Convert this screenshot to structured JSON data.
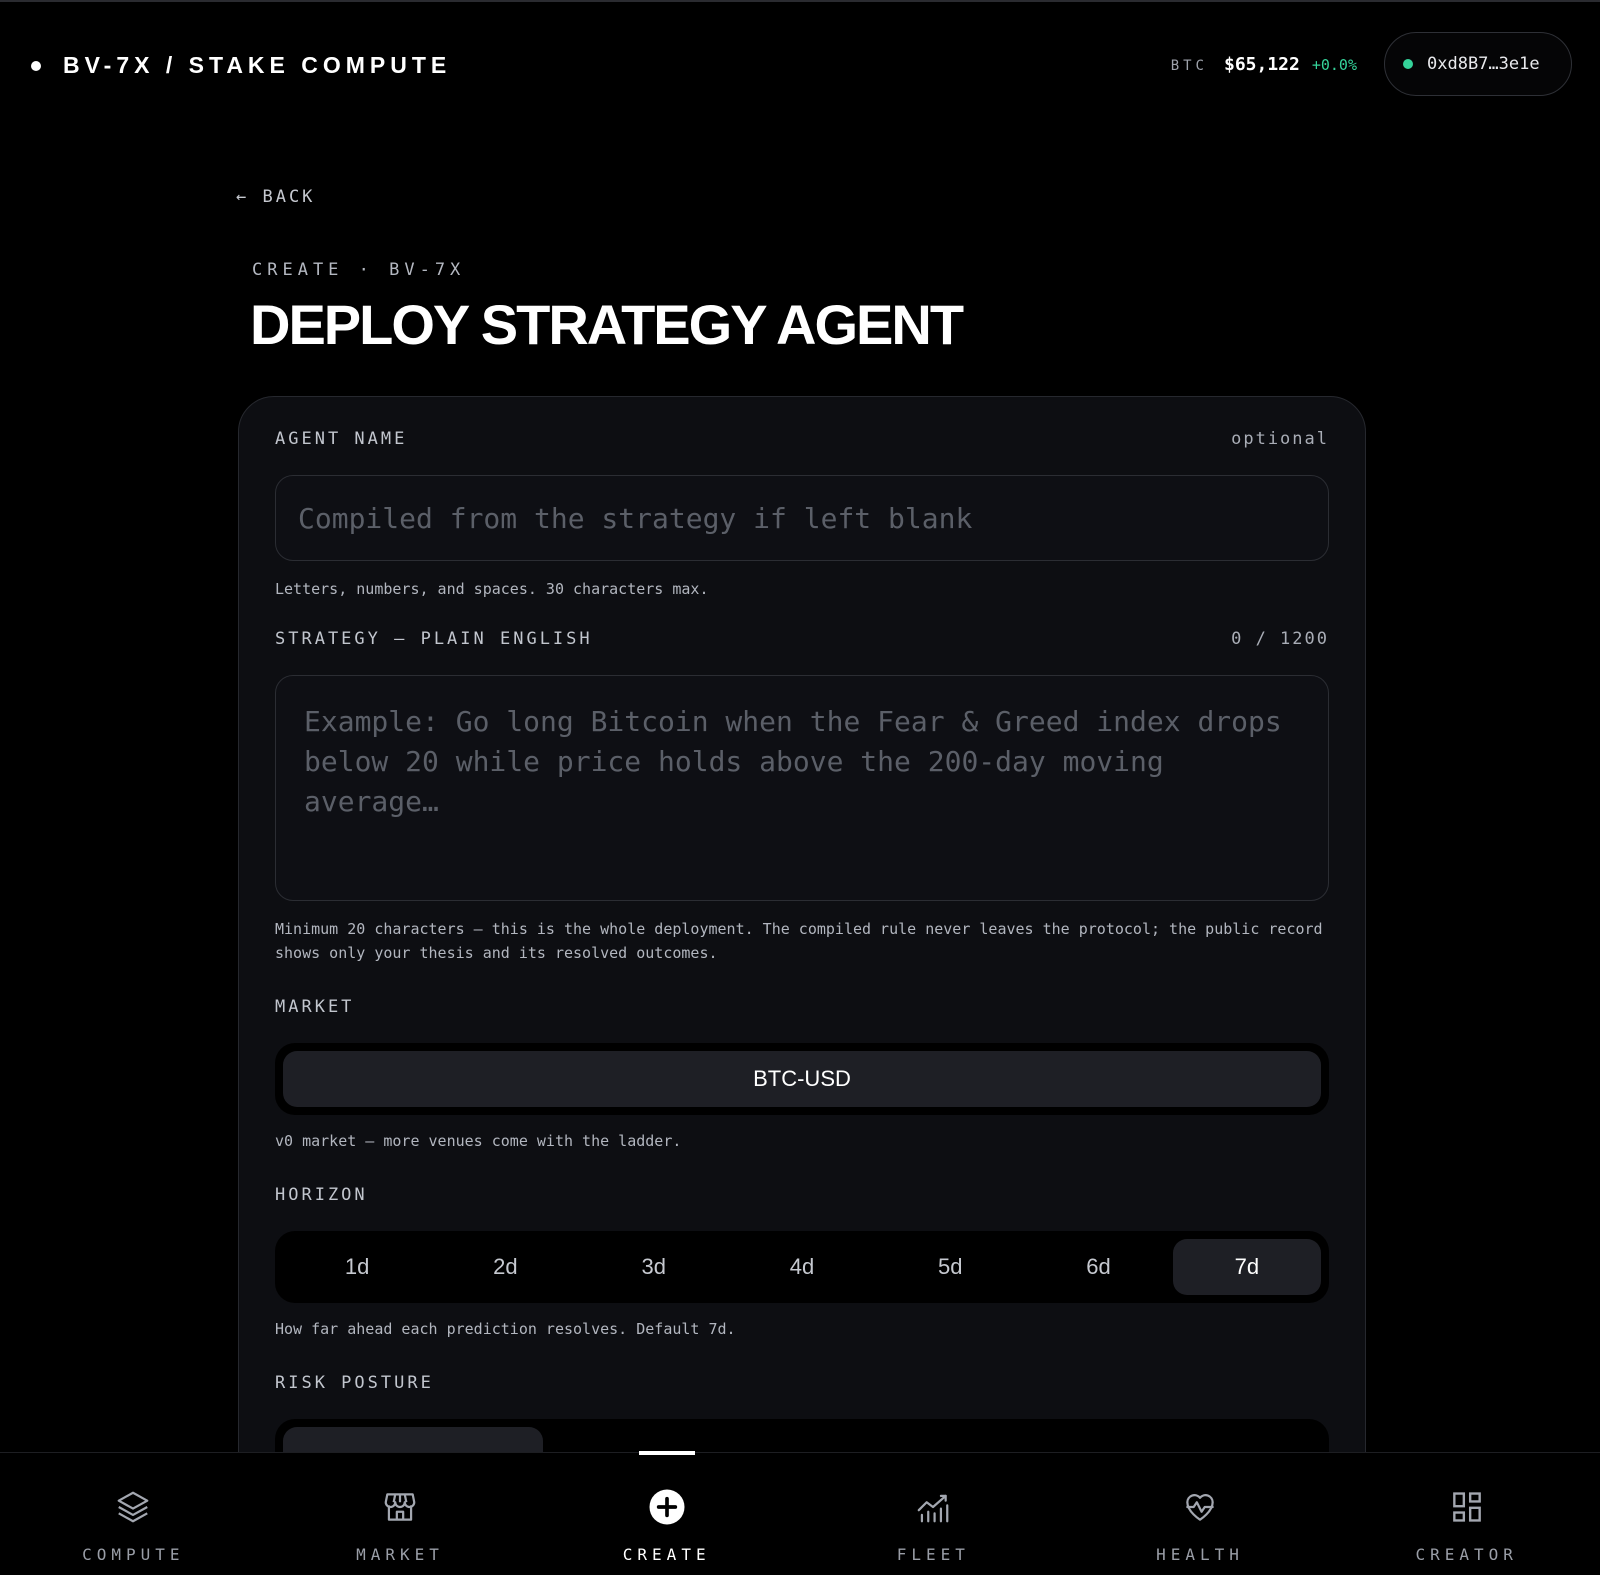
{
  "header": {
    "brand": "BV-7X / STAKE COMPUTE",
    "ticker": {
      "symbol": "BTC",
      "price": "$65,122",
      "change": "+0.0%"
    },
    "wallet": {
      "address": "0xd8B7…3e1e",
      "status_color": "#35d39a"
    }
  },
  "page": {
    "back_label": "← BACK",
    "eyebrow": "CREATE · BV-7X",
    "title": "DEPLOY STRATEGY AGENT"
  },
  "form": {
    "agent_name": {
      "label": "AGENT NAME",
      "meta": "optional",
      "value": "",
      "placeholder": "Compiled from the strategy if left blank",
      "help": "Letters, numbers, and spaces. 30 characters max."
    },
    "strategy": {
      "label": "STRATEGY — PLAIN ENGLISH",
      "counter": "0 / 1200",
      "value": "",
      "placeholder": "Example: Go long Bitcoin when the Fear & Greed index drops below 20 while price holds above the 200-day moving average…",
      "help": "Minimum 20 characters — this is the whole deployment. The compiled rule never leaves the protocol; the public record shows only your thesis and its resolved outcomes."
    },
    "market": {
      "label": "MARKET",
      "options": [
        "BTC-USD"
      ],
      "selected": "BTC-USD",
      "help": "v0 market — more venues come with the ladder."
    },
    "horizon": {
      "label": "HORIZON",
      "options": [
        "1d",
        "2d",
        "3d",
        "4d",
        "5d",
        "6d",
        "7d"
      ],
      "selected": "7d",
      "help": "How far ahead each prediction resolves. Default 7d."
    },
    "risk_posture": {
      "label": "RISK POSTURE"
    }
  },
  "nav": {
    "items": [
      {
        "label": "COMPUTE",
        "icon": "layers-icon"
      },
      {
        "label": "MARKET",
        "icon": "storefront-icon"
      },
      {
        "label": "CREATE",
        "icon": "plus-circle-icon",
        "active": true
      },
      {
        "label": "FLEET",
        "icon": "chart-icon"
      },
      {
        "label": "HEALTH",
        "icon": "heart-pulse-icon"
      },
      {
        "label": "CREATOR",
        "icon": "grid-icon"
      }
    ]
  },
  "colors": {
    "accent_green": "#35d39a",
    "background": "#000000",
    "card": "#0d0e12"
  }
}
